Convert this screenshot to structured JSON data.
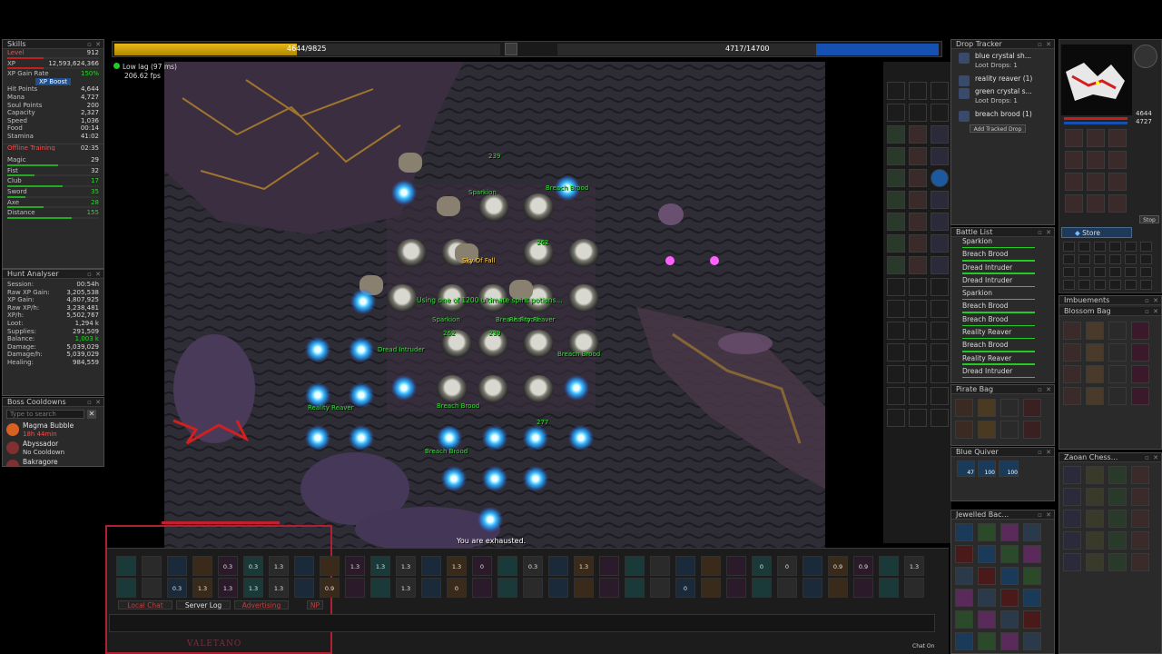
{
  "top_bars": {
    "health_text": "4644/9825",
    "health_fraction": 0.473,
    "mana_text": "4717/14700",
    "mana_fraction": 0.321
  },
  "status": {
    "lag": "Low lag (97 ms)",
    "fps": "206.62 fps"
  },
  "skills": {
    "title": "Skills",
    "rows": [
      {
        "label": "Level",
        "value": "912"
      },
      {
        "label": "XP",
        "value": "12,593,624,366"
      },
      {
        "label": "XP Gain Rate",
        "value": "150%"
      },
      {
        "label": "",
        "value": "XP Boost"
      },
      {
        "label": "Hit Points",
        "value": "4,644"
      },
      {
        "label": "Mana",
        "value": "4,727"
      },
      {
        "label": "Soul Points",
        "value": "200"
      },
      {
        "label": "Capacity",
        "value": "2,327"
      },
      {
        "label": "Speed",
        "value": "1,036"
      },
      {
        "label": "Food",
        "value": "00:14"
      },
      {
        "label": "Stamina",
        "value": "41:02"
      }
    ],
    "offline_label": "Offline Training",
    "offline_value": "02:35",
    "combat": [
      {
        "label": "Magic",
        "value": "29",
        "fill": 0.55
      },
      {
        "label": "Fist",
        "value": "32",
        "fill": 0.3
      },
      {
        "label": "Club",
        "value": "17",
        "fill": 0.6
      },
      {
        "label": "Sword",
        "value": "35",
        "fill": 0.2
      },
      {
        "label": "Axe",
        "value": "28",
        "fill": 0.4
      },
      {
        "label": "Distance",
        "value": "155",
        "fill": 0.7
      }
    ]
  },
  "hunt": {
    "title": "Hunt Analyser",
    "rows": [
      {
        "label": "Session:",
        "value": "00:54h"
      },
      {
        "label": "Raw XP Gain:",
        "value": "3,205,538"
      },
      {
        "label": "XP Gain:",
        "value": "4,807,925"
      },
      {
        "label": "Raw XP/h:",
        "value": "3,238,481"
      },
      {
        "label": "XP/h:",
        "value": "5,502,767"
      },
      {
        "label": "Loot:",
        "value": "1,294 k"
      },
      {
        "label": "Supplies:",
        "value": "291,509"
      },
      {
        "label": "Balance:",
        "value": "1,003 k"
      },
      {
        "label": "Damage:",
        "value": "5,039,029"
      },
      {
        "label": "Damage/h:",
        "value": "5,039,029"
      },
      {
        "label": "Healing:",
        "value": "984,559"
      }
    ]
  },
  "boss": {
    "title": "Boss Cooldowns",
    "search_placeholder": "Type to search",
    "items": [
      {
        "name": "Magma Bubble",
        "time": "18h 44min"
      },
      {
        "name": "Abyssador",
        "time": "No Cooldown"
      },
      {
        "name": "Bakragore",
        "time": ""
      }
    ]
  },
  "drop_tracker": {
    "title": "Drop Tracker",
    "items": [
      {
        "name": "blue crystal sh...",
        "sub": "Loot Drops: 1"
      },
      {
        "name": "reality reaver (1)",
        "sub": ""
      },
      {
        "name": "green crystal s...",
        "sub": "Loot Drops: 1"
      },
      {
        "name": "breach brood (1)",
        "sub": ""
      }
    ],
    "add_label": "Add Tracked Drop"
  },
  "battle": {
    "title": "Battle List",
    "items": [
      "Sparkion",
      "Breach Brood",
      "Dread Intruder",
      "Dread Intruder",
      "Sparkion",
      "Breach Brood",
      "Breach Brood",
      "Reality Reaver",
      "Breach Brood",
      "Reality Reaver",
      "Dread Intruder"
    ]
  },
  "containers": {
    "pirate_bag": "Pirate Bag",
    "blue_quiver": "Blue Quiver",
    "quiver_counts": [
      "47",
      "100",
      "100"
    ],
    "jewelled": "Jewelled Bac...",
    "imbuements": "Imbuements",
    "blossom": "Blossom Bag",
    "zaoan": "Zaoan Chess..."
  },
  "minimap": {
    "hp": "4644",
    "mana": "4727",
    "store_label": "Store",
    "stop_label": "Stop"
  },
  "game": {
    "status_message": "You are exhausted.",
    "server_message": "Using one of 1200 ultimate spirit potions...",
    "names": [
      {
        "text": "Sparkion"
      },
      {
        "text": "Breach Brood"
      },
      {
        "text": "Sky Of Fall"
      },
      {
        "text": "Sparkion"
      },
      {
        "text": "Breach Brood"
      },
      {
        "text": "Reality Reaver"
      },
      {
        "text": "Dread Intruder"
      },
      {
        "text": "Breach Brood"
      },
      {
        "text": "Reality Reaver"
      },
      {
        "text": "Breach Brood"
      },
      {
        "text": "Breach Brood"
      }
    ],
    "damage_numbers": [
      "239",
      "262",
      "239",
      "262",
      "277"
    ]
  },
  "chat": {
    "tabs": [
      "Local Chat",
      "Server Log",
      "Advertising",
      "NP"
    ],
    "character": "VALETANO",
    "chat_on": "Chat On"
  },
  "hotkeys": {
    "row1": [
      "",
      "",
      "",
      "",
      "0.3",
      "0.3",
      "1.3",
      "",
      "",
      "1.3",
      "1.3",
      "1.3",
      "",
      "1.3",
      "0",
      "",
      "0.3",
      "",
      "1.3",
      "",
      "",
      "",
      "",
      "",
      "",
      "0",
      "0",
      "",
      "0.9",
      "0.9",
      "",
      "1.3"
    ],
    "row2": [
      "",
      "",
      "0.3",
      "1.3",
      "1.3",
      "1.3",
      "1.3",
      "",
      "0.9",
      "",
      "",
      "1.3",
      "",
      "0",
      "",
      "",
      "",
      "",
      "",
      "",
      "",
      "",
      "0",
      "",
      "",
      "",
      "",
      "",
      "",
      "",
      "",
      ""
    ]
  },
  "colors": {
    "health": "#d8a808",
    "mana": "#1650b0",
    "name_green": "#30e030",
    "accent_red": "#c02020"
  }
}
